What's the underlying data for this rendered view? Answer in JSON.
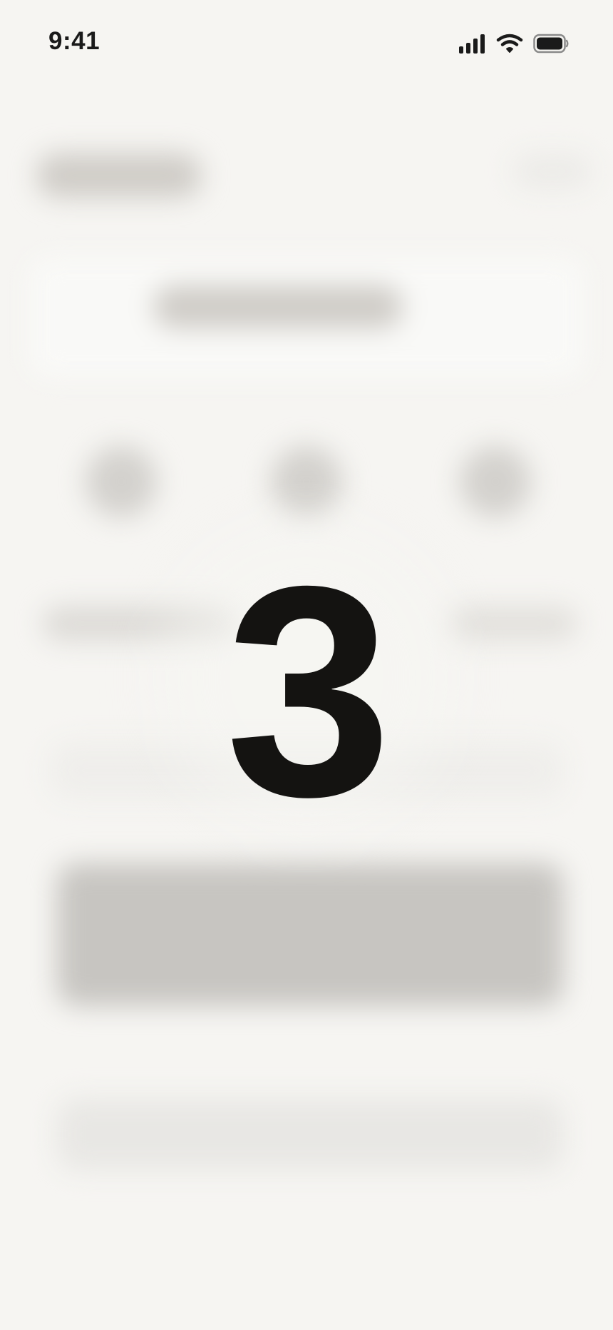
{
  "status_bar": {
    "time": "9:41",
    "signal_icon": "cellular-signal-icon",
    "wifi_icon": "wifi-icon",
    "battery_icon": "battery-icon"
  },
  "countdown": {
    "value": "3"
  },
  "colors": {
    "background": "#f6f5f2",
    "countdown_text": "#141311",
    "status_text": "#1a1a1a"
  }
}
